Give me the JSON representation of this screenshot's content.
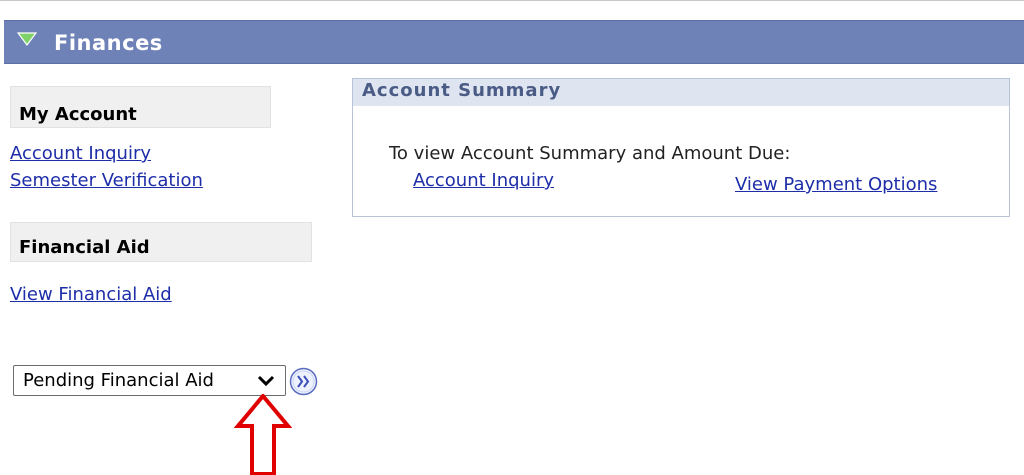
{
  "header": {
    "title": "Finances"
  },
  "sidebar": {
    "my_account": {
      "title": "My Account",
      "links": [
        "Account Inquiry",
        "Semester Verification"
      ]
    },
    "financial_aid": {
      "title": "Financial Aid",
      "links": [
        "View Financial Aid"
      ]
    },
    "select": {
      "value": "Pending Financial Aid"
    }
  },
  "summary": {
    "title": "Account Summary",
    "description": "To view Account Summary and Amount Due:",
    "link_inquiry": "Account Inquiry",
    "link_payment": "View Payment Options"
  },
  "colors": {
    "header_bg": "#6f82b7",
    "link": "#1d2ea8",
    "annotation_arrow": "#e00000",
    "triangle": "#7fd16a"
  },
  "icons": {
    "header_toggle": "triangle-down-icon",
    "dropdown": "chevron-down-icon",
    "go": "double-chevron-right-icon",
    "annotation": "up-arrow-icon"
  }
}
